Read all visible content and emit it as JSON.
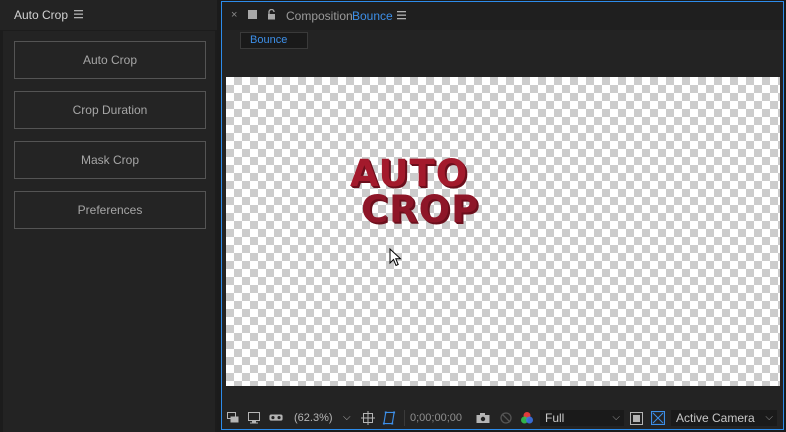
{
  "left_panel": {
    "title": "Auto Crop",
    "buttons": [
      {
        "label": "Auto Crop"
      },
      {
        "label": "Crop Duration"
      },
      {
        "label": "Mask Crop"
      },
      {
        "label": "Preferences"
      }
    ]
  },
  "comp_panel": {
    "close_glyph": "×",
    "label": "Composition",
    "name": "Bounce",
    "active_tab": "Bounce"
  },
  "canvas": {
    "logo_line1": "AUTO",
    "logo_line2": "CROP"
  },
  "toolbar": {
    "zoom": "(62.3%)",
    "timecode": "0;00;00;00",
    "resolution": "Full",
    "camera": "Active Camera"
  },
  "colors": {
    "accent": "#2d8ceb",
    "logo_red": "#a31a2c"
  }
}
